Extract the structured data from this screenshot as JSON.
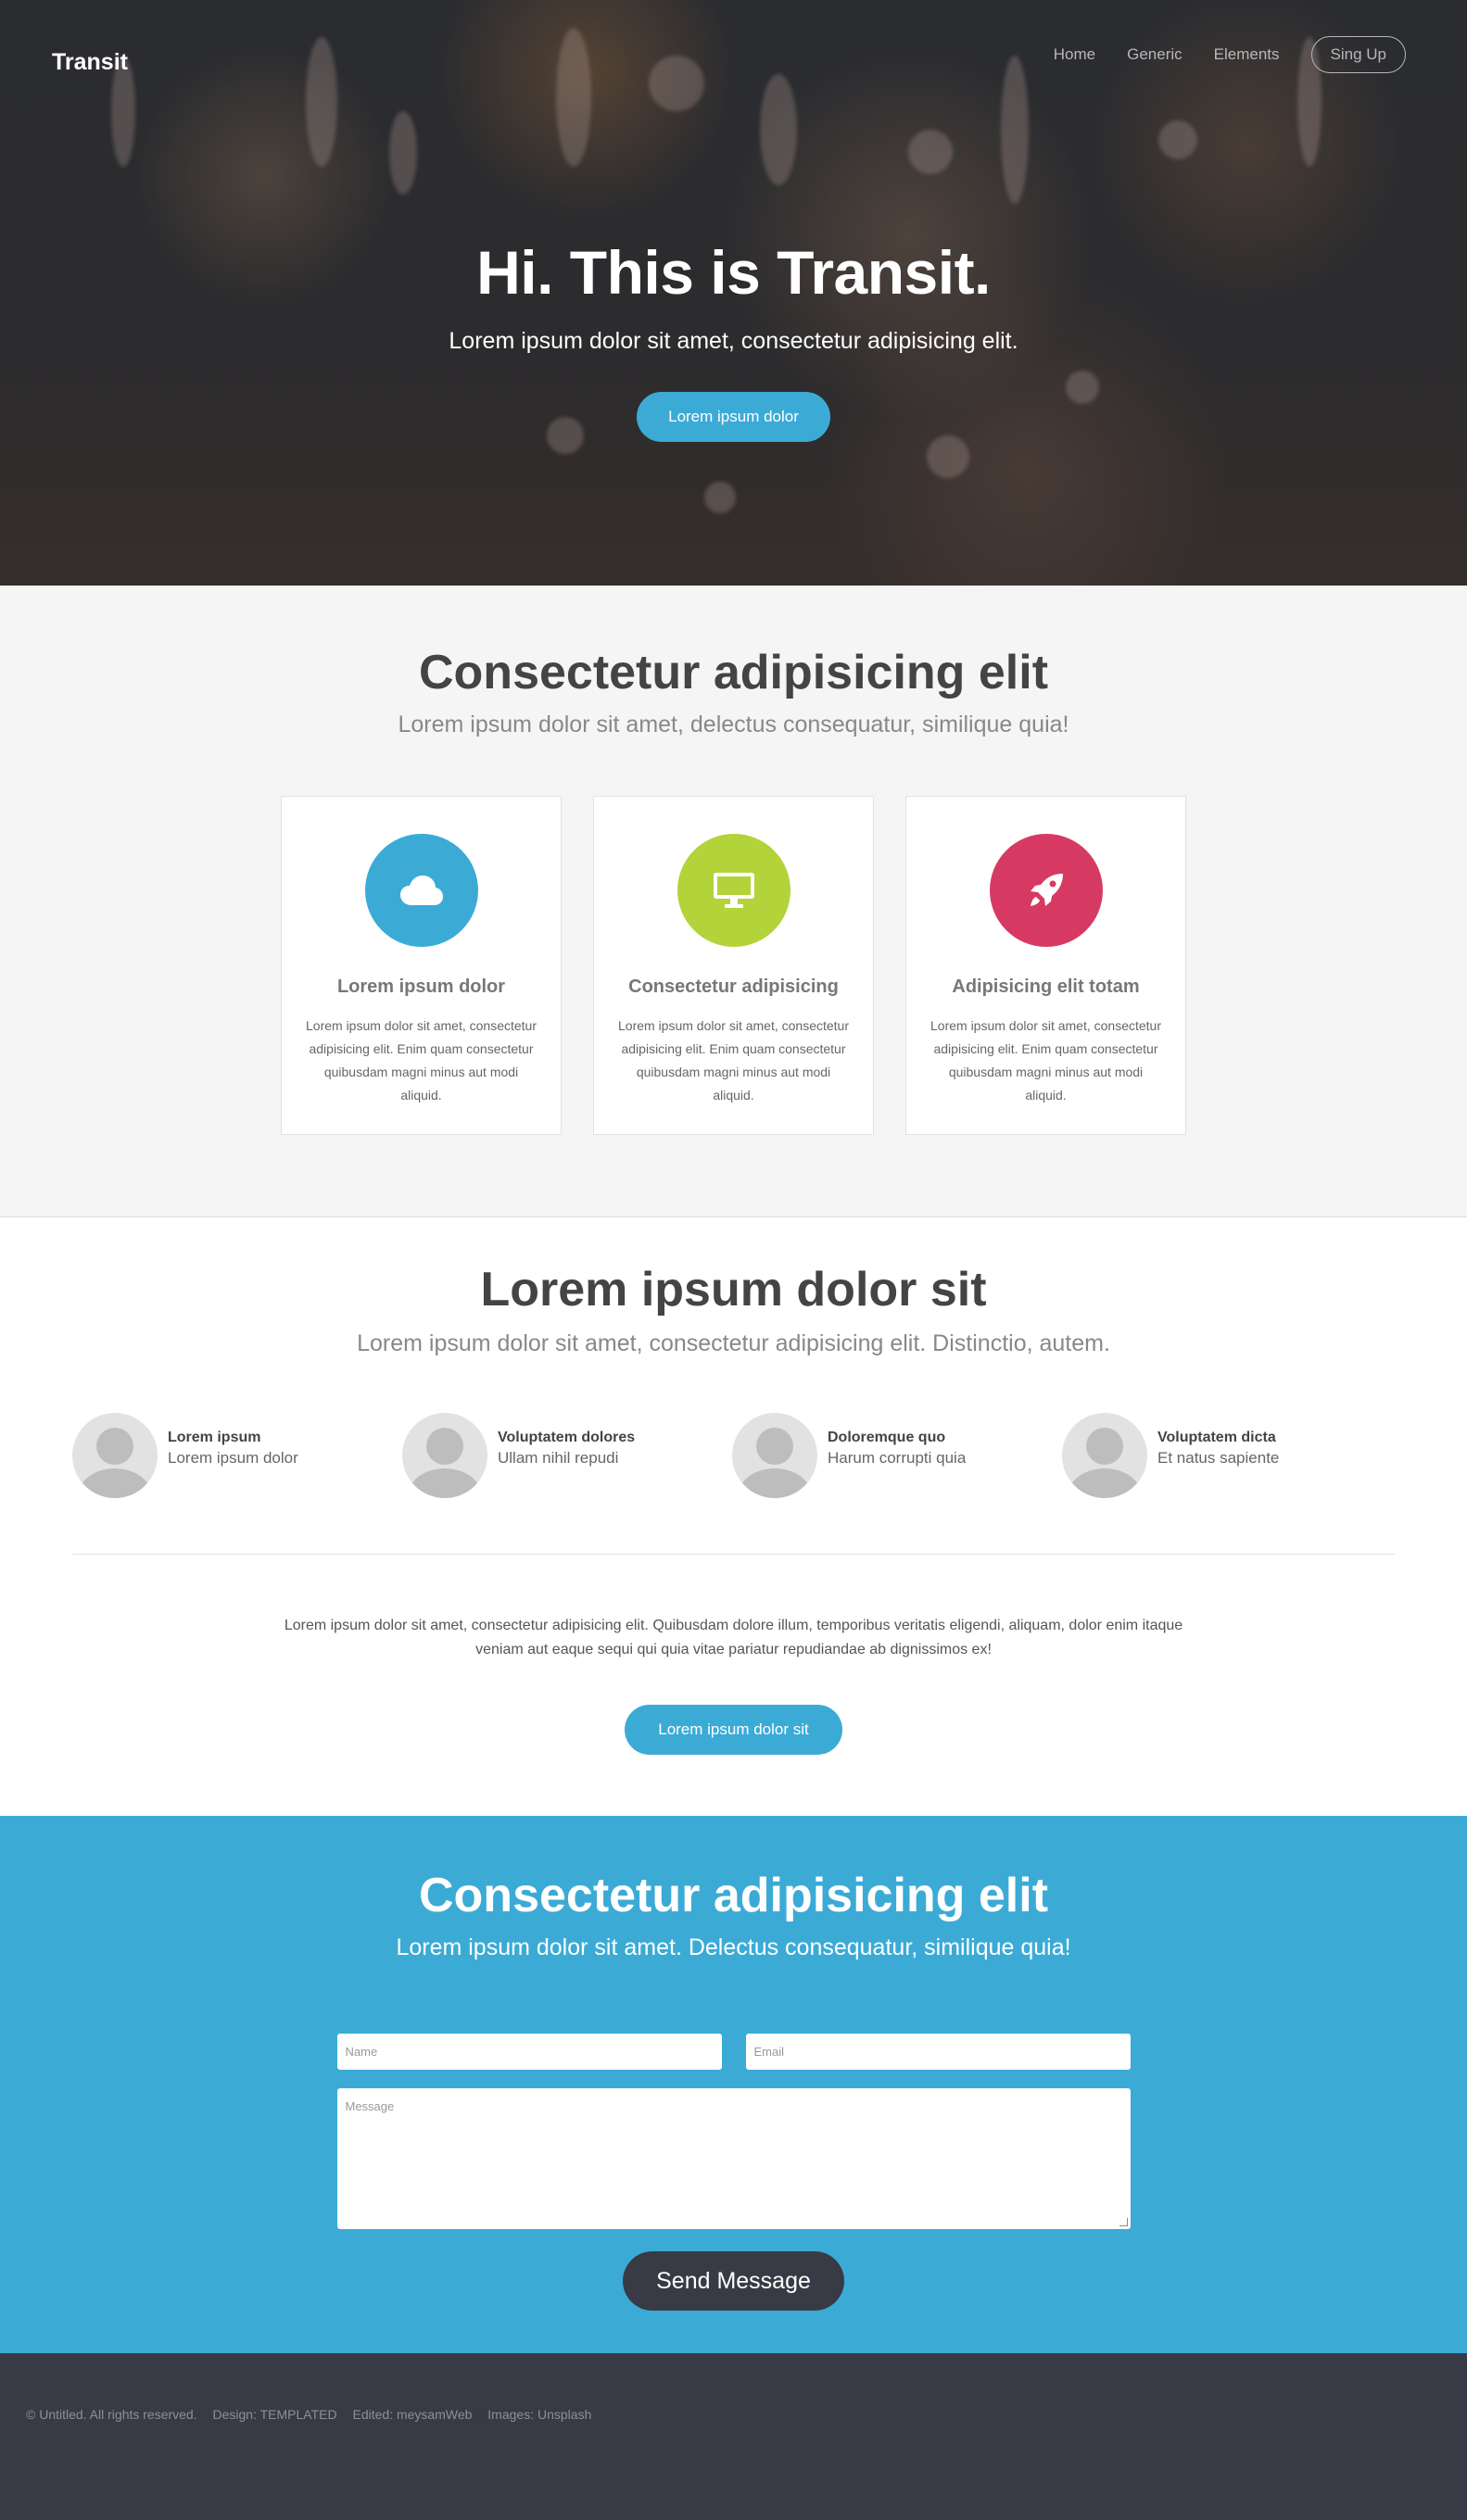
{
  "header": {
    "logo": "Transit",
    "nav": [
      "Home",
      "Generic",
      "Elements"
    ],
    "signup": "Sing Up"
  },
  "hero": {
    "title": "Hi. This is Transit.",
    "subtitle": "Lorem ipsum dolor sit amet, consectetur adipisicing elit.",
    "button": "Lorem ipsum dolor"
  },
  "features": {
    "title": "Consectetur adipisicing elit",
    "subtitle": "Lorem ipsum dolor sit amet, delectus consequatur, similique quia!",
    "cards": [
      {
        "icon": "cloud-icon",
        "color": "#3babd6",
        "title": "Lorem ipsum dolor",
        "text": "Lorem ipsum dolor sit amet, consectetur adipisicing elit. Enim quam consectetur quibusdam magni minus aut modi aliquid."
      },
      {
        "icon": "desktop-icon",
        "color": "#b3d33a",
        "title": "Consectetur adipisicing",
        "text": "Lorem ipsum dolor sit amet, consectetur adipisicing elit. Enim quam consectetur quibusdam magni minus aut modi aliquid."
      },
      {
        "icon": "rocket-icon",
        "color": "#d63a62",
        "title": "Adipisicing elit totam",
        "text": "Lorem ipsum dolor sit amet, consectetur adipisicing elit. Enim quam consectetur quibusdam magni minus aut modi aliquid."
      }
    ]
  },
  "team": {
    "title": "Lorem ipsum dolor sit",
    "subtitle": "Lorem ipsum dolor sit amet, consectetur adipisicing elit. Distinctio, autem.",
    "people": [
      {
        "name": "Lorem ipsum",
        "role": "Lorem ipsum dolor"
      },
      {
        "name": "Voluptatem dolores",
        "role": "Ullam nihil repudi"
      },
      {
        "name": "Doloremque quo",
        "role": "Harum corrupti quia"
      },
      {
        "name": "Voluptatem dicta",
        "role": "Et natus sapiente"
      }
    ],
    "paragraph": "Lorem ipsum dolor sit amet, consectetur adipisicing elit. Quibusdam dolore illum, temporibus veritatis eligendi, aliquam, dolor enim itaque veniam aut eaque sequi qui quia vitae pariatur repudiandae ab dignissimos ex!",
    "button": "Lorem ipsum dolor sit"
  },
  "contact": {
    "title": "Consectetur adipisicing elit",
    "subtitle": "Lorem ipsum dolor sit amet. Delectus consequatur, similique quia!",
    "name_placeholder": "Name",
    "email_placeholder": "Email",
    "message_placeholder": "Message",
    "send": "Send Message"
  },
  "footer": {
    "items": [
      "© Untitled. All rights reserved.",
      "Design: TEMPLATED",
      "Edited: meysamWeb",
      "Images: Unsplash"
    ]
  },
  "colors": {
    "accent": "#3babd6",
    "dark": "#383a45"
  }
}
